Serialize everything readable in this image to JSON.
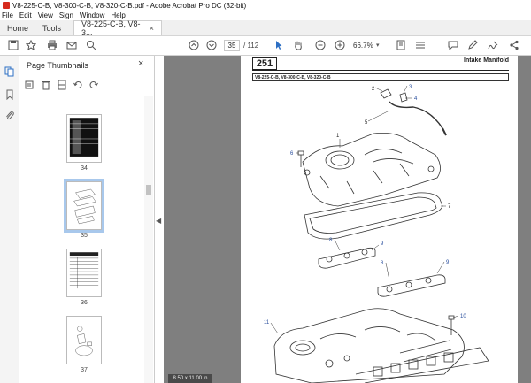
{
  "window": {
    "title": "V8-225-C-B, V8-300-C-B, V8-320-C-B.pdf - Adobe Acrobat Pro DC (32-bit)"
  },
  "menu": [
    "File",
    "Edit",
    "View",
    "Sign",
    "Window",
    "Help"
  ],
  "tabs": {
    "home": "Home",
    "tools": "Tools",
    "document": "V8-225-C-B, V8-3...",
    "close": "×"
  },
  "toolbar": {
    "page_current": "35",
    "page_total": "/ 112",
    "zoom": "66.7%",
    "zoom_dropdown": "▾"
  },
  "panel": {
    "title": "Page Thumbnails",
    "close": "×",
    "thumbnails": [
      {
        "label": "34"
      },
      {
        "label": "35"
      },
      {
        "label": "36"
      },
      {
        "label": "37"
      }
    ]
  },
  "document": {
    "page_number": "251",
    "section_title": "Intake Manifold",
    "models": "V8-225-C-B, V8-300-C-B, V8-320-C-B",
    "callouts": [
      "1",
      "2",
      "3",
      "4",
      "5",
      "6",
      "7",
      "8",
      "9",
      "8",
      "9",
      "10",
      "11"
    ]
  },
  "status": {
    "page_size": "8.50 x 11.00 in"
  },
  "icons": {
    "save": "save-icon",
    "bookmark": "star-icon",
    "print": "print-icon",
    "email": "mail-icon",
    "search": "search-icon",
    "prev": "arrow-up-icon",
    "next": "arrow-down-icon",
    "select": "cursor-icon",
    "hand": "hand-icon",
    "zoom_out": "minus-icon",
    "zoom_in": "plus-icon"
  }
}
